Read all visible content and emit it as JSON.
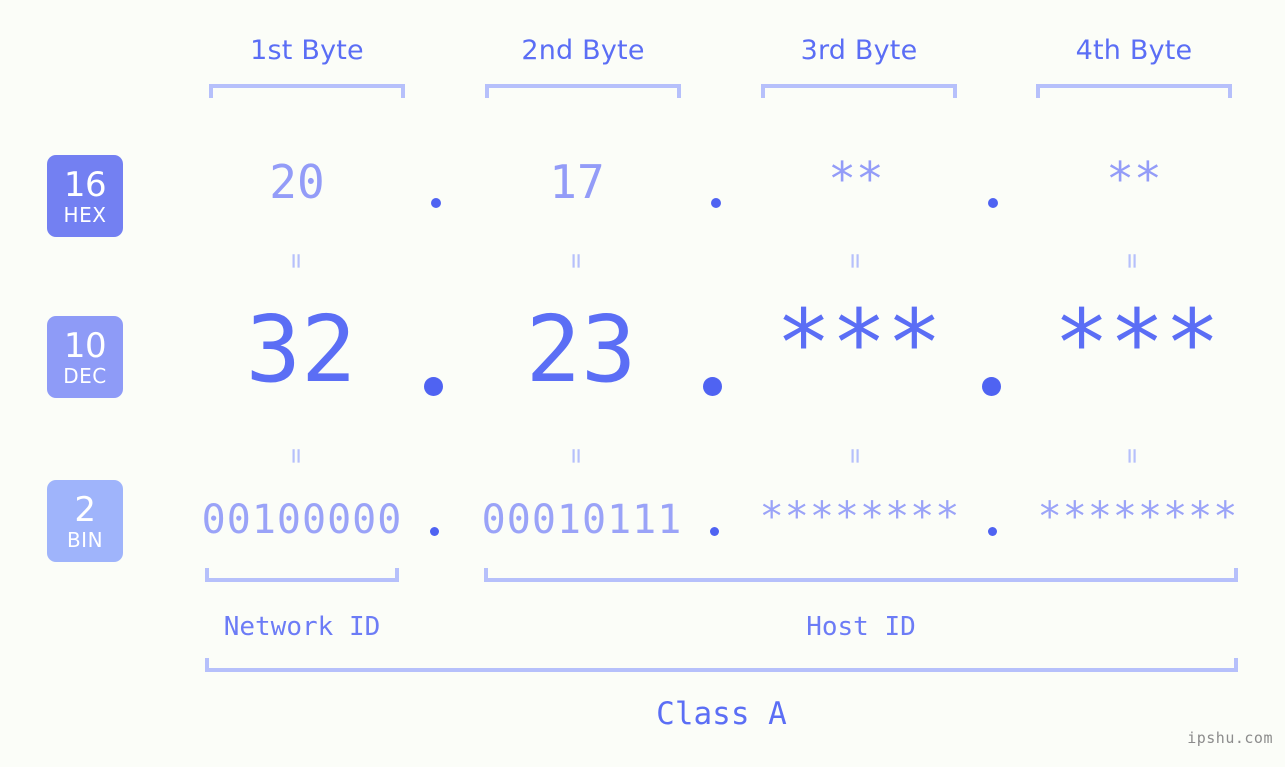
{
  "theme": {
    "background": "#fbfdf8",
    "accent": "#5b6ef5",
    "accent_light": "#9aa3f8",
    "bracket": "#b6c0fb",
    "badge_hex": "#7380f2",
    "badge_dec": "#8e9bf7",
    "badge_bin": "#9fb4fb",
    "watermark": "#8c8c8c"
  },
  "headers": [
    {
      "label": "1st Byte"
    },
    {
      "label": "2nd Byte"
    },
    {
      "label": "3rd Byte"
    },
    {
      "label": "4th Byte"
    }
  ],
  "bases": [
    {
      "num": "16",
      "name": "HEX"
    },
    {
      "num": "10",
      "name": "DEC"
    },
    {
      "num": "2",
      "name": "BIN"
    }
  ],
  "rows": {
    "hex": {
      "bytes": [
        "20",
        "17",
        "**",
        "**"
      ]
    },
    "dec": {
      "bytes": [
        "32",
        "23",
        "***",
        "***"
      ]
    },
    "bin": {
      "bytes": [
        "00100000",
        "00010111",
        "********",
        "********"
      ]
    }
  },
  "separators": {
    "symbol": "."
  },
  "equals": {
    "symbol": "="
  },
  "sections": [
    {
      "label": "Network ID"
    },
    {
      "label": "Host ID"
    }
  ],
  "klass": {
    "label": "Class A"
  },
  "watermark": {
    "text": "ipshu.com"
  }
}
